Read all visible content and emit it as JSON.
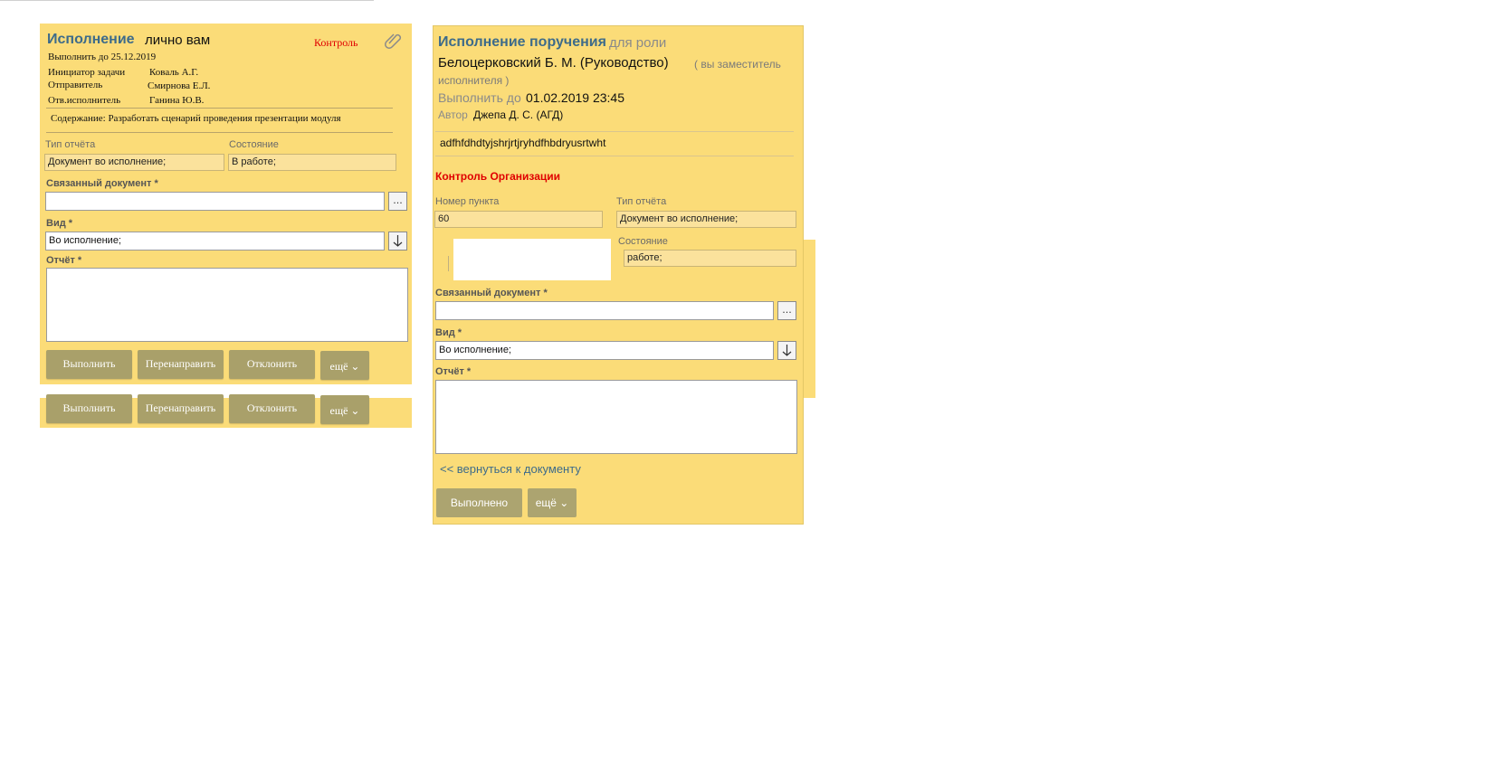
{
  "left_card": {
    "title": "Исполнение",
    "subtitle": "лично вам",
    "control": "Контроль",
    "due": "Выполнить до 25.12.2019",
    "initiator_label": "Инициатор задачи",
    "initiator_value": "Коваль А.Г.",
    "sender_label": "Отправитель",
    "sender_value": "Смирнова Е.Л.",
    "executor_label": "Отв.исполнитель",
    "executor_value": "Ганина Ю.В.",
    "content": "Содержание: Разработать сценарий проведения презентации модуля",
    "report_type_label": "Тип отчёта",
    "report_type_value": "Документ во исполнение;",
    "state_label": "Состояние",
    "state_value": "В работе;",
    "linked_doc_label": "Связанный документ  *",
    "linked_doc_value": "",
    "browse_btn": "...",
    "kind_label": "Вид  *",
    "kind_value": "Во исполнение;",
    "report_label": "Отчёт  *",
    "report_value": "",
    "buttons": [
      "Выполнить",
      "Перенаправить",
      "Отклонить",
      "ещё ⌄"
    ],
    "buttons_dup": [
      "Выполнить",
      "Перенаправить",
      "Отклонить",
      "ещё ⌄"
    ]
  },
  "right_card": {
    "title": "Исполнение поручения",
    "role_prefix": "для роли",
    "role_name": "Белоцерковский Б. М. (Руководство)",
    "role_note": "( вы заместитель",
    "role_note2": "исполнителя )",
    "due_label": "Выполнить до",
    "due_value": "01.02.2019 23:45",
    "author_label": "Автор",
    "author_value": "Джепа Д. С. (АГД)",
    "text": "adfhfdhdtyjshrjrtjryhdfhbdryusrtwht",
    "control_org": "Контроль Организации",
    "item_no_label": "Номер пункта",
    "item_no_value": "60",
    "report_type_label": "Тип отчёта",
    "report_type_value": "Документ во исполнение;",
    "state_label": "Состояние",
    "state_value": "работе;",
    "linked_doc_label": "Связанный документ  *",
    "linked_doc_value": "",
    "browse_btn": "...",
    "kind_label": "Вид  *",
    "kind_value": "Во исполнение;",
    "report_label": "Отчёт  *",
    "report_value": "",
    "back_link": "<< вернуться к документу",
    "done_btn": "Выполнено",
    "more_btn": "ещё ⌄"
  },
  "colors": {
    "card_bg": "#fbdc78",
    "title": "#3d6b8a",
    "control_red": "#e00000",
    "button_bg": "#a9a06a"
  }
}
